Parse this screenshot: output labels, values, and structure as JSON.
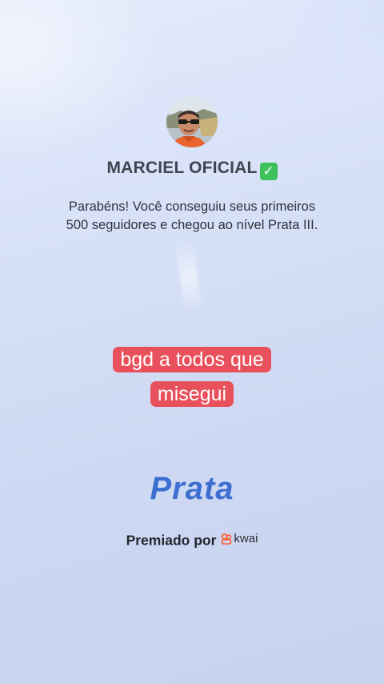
{
  "profile": {
    "username": "MARCIEL OFICIAL",
    "verified_icon": "check-mark-button-icon",
    "verified_color": "#3ec15a"
  },
  "message": {
    "line1": "Parabéns! Você conseguiu seus primeiros",
    "line2": "500 seguidores e chegou ao nível Prata III."
  },
  "caption": {
    "line1": "bgd a todos que",
    "line2": "misegui",
    "background_color": "#e8505b"
  },
  "level": {
    "name": "Prata",
    "color": "#3d6fd1"
  },
  "award": {
    "label": "Premiado por",
    "brand": "kwai",
    "brand_icon": "kwai-logo-icon",
    "brand_color": "#ff5b2e"
  }
}
